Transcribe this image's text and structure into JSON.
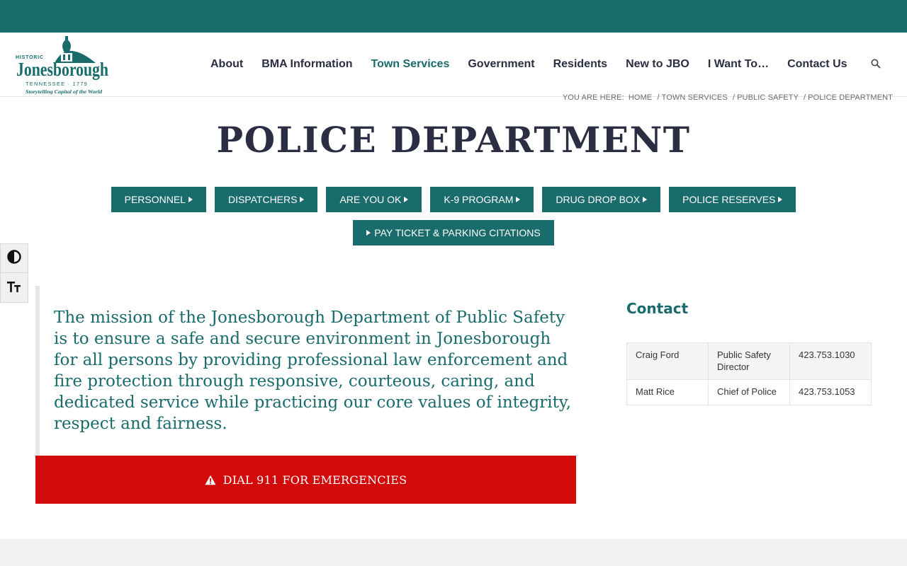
{
  "brand": {
    "logo_top": "HISTORIC",
    "logo_name": "Jonesborough",
    "logo_sub": "TENNESSEE · 1779",
    "logo_tagline": "Storytelling Capital of the World",
    "primary_color": "#1a6b6b",
    "emergency_color": "#d20a0a"
  },
  "nav": {
    "items": [
      {
        "label": "About",
        "active": false
      },
      {
        "label": "BMA Information",
        "active": false
      },
      {
        "label": "Town Services",
        "active": true
      },
      {
        "label": "Government",
        "active": false
      },
      {
        "label": "Residents",
        "active": false
      },
      {
        "label": "New to JBO",
        "active": false
      },
      {
        "label": "I Want To…",
        "active": false
      },
      {
        "label": "Contact Us",
        "active": false
      }
    ],
    "search_icon": "search-icon"
  },
  "breadcrumb": {
    "prefix": "YOU ARE HERE:",
    "items": [
      "HOME",
      "TOWN SERVICES",
      "PUBLIC SAFETY",
      "POLICE DEPARTMENT"
    ]
  },
  "page": {
    "title": "POLICE DEPARTMENT"
  },
  "subnav": {
    "row1": [
      "PERSONNEL",
      "DISPATCHERS",
      "ARE YOU OK",
      "K-9 PROGRAM",
      "DRUG DROP BOX",
      "POLICE RESERVES"
    ],
    "row2": [
      "PAY TICKET & PARKING CITATIONS"
    ]
  },
  "accessibility": {
    "contrast_icon": "contrast-icon",
    "font_size_icon": "text-size-icon"
  },
  "mission": {
    "text": "The mission of the Jonesborough Department of Public Safety is to ensure a safe and secure environment in Jonesborough for all persons by providing professional law enforcement and fire protection through responsive, courteous, caring, and dedicated service while practicing our core values of integrity, respect and fairness."
  },
  "emergency": {
    "label": "DIAL 911 FOR EMERGENCIES",
    "icon": "warning-icon"
  },
  "contact": {
    "heading": "Contact",
    "rows": [
      {
        "name": "Craig Ford",
        "title": "Public Safety Director",
        "phone": "423.753.1030"
      },
      {
        "name": "Matt Rice",
        "title": "Chief of Police",
        "phone": "423.753.1053"
      }
    ]
  }
}
